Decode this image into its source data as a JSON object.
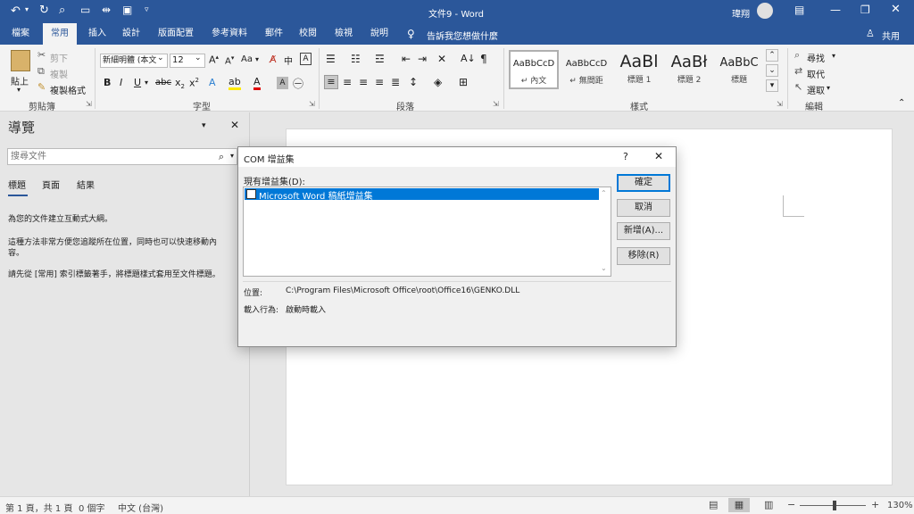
{
  "title_bar": {
    "doc_title": "文件9 - Word",
    "user_name": "瑋翔"
  },
  "ribbon_tabs": [
    {
      "label": "檔案"
    },
    {
      "label": "常用"
    },
    {
      "label": "插入"
    },
    {
      "label": "設計"
    },
    {
      "label": "版面配置"
    },
    {
      "label": "參考資料"
    },
    {
      "label": "郵件"
    },
    {
      "label": "校閱"
    },
    {
      "label": "檢視"
    },
    {
      "label": "說明"
    }
  ],
  "tell_me": "告訴我您想做什麼",
  "share": "共用",
  "clipboard": {
    "paste": "貼上",
    "cut": "剪下",
    "copy": "複製",
    "format_painter": "複製格式",
    "group_label": "剪貼簿"
  },
  "font": {
    "font_name": "新細明體 (本文",
    "font_size": "12",
    "case_label": "Aa",
    "group_label": "字型"
  },
  "paragraph": {
    "group_label": "段落"
  },
  "styles": {
    "items": [
      {
        "sample": "AaBbCcD",
        "name": "↵ 內文"
      },
      {
        "sample": "AaBbCcD",
        "name": "↵ 無間距"
      },
      {
        "sample": "AaBl",
        "name": "標題 1"
      },
      {
        "sample": "AaBł",
        "name": "標題 2"
      },
      {
        "sample": "AaBbC",
        "name": "標題"
      }
    ],
    "group_label": "樣式"
  },
  "editing": {
    "find": "尋找",
    "replace": "取代",
    "select": "選取",
    "group_label": "編輯"
  },
  "navigation": {
    "title": "導覽",
    "search_placeholder": "搜尋文件",
    "tabs": [
      {
        "label": "標題"
      },
      {
        "label": "頁面"
      },
      {
        "label": "結果"
      }
    ],
    "text1": "為您的文件建立互動式大綱。",
    "text2a": "這種方法非常方便您追蹤所在位置，同時也可以快速移動內",
    "text2b": "容。",
    "text3": "請先從 [常用] 索引標籤著手，將標題樣式套用至文件標題。"
  },
  "dialog": {
    "title": "COM 增益集",
    "help": "?",
    "available_label": "現有增益集(D):",
    "addins": [
      {
        "name": "Microsoft Word 稿紙增益集"
      }
    ],
    "location_label": "位置:",
    "location_value": "C:\\Program Files\\Microsoft Office\\root\\Office16\\GENKO.DLL",
    "load_label": "載入行為:",
    "load_value": "啟動時載入",
    "buttons": {
      "ok": "確定",
      "cancel": "取消",
      "add": "新增(A)...",
      "remove": "移除(R)"
    }
  },
  "status": {
    "page": "第 1 頁，共 1 頁",
    "words": "0 個字",
    "language": "中文 (台灣)",
    "zoom": "130%"
  },
  "colors": {
    "accent": "#2b579a",
    "highlight": "#0078d7"
  }
}
